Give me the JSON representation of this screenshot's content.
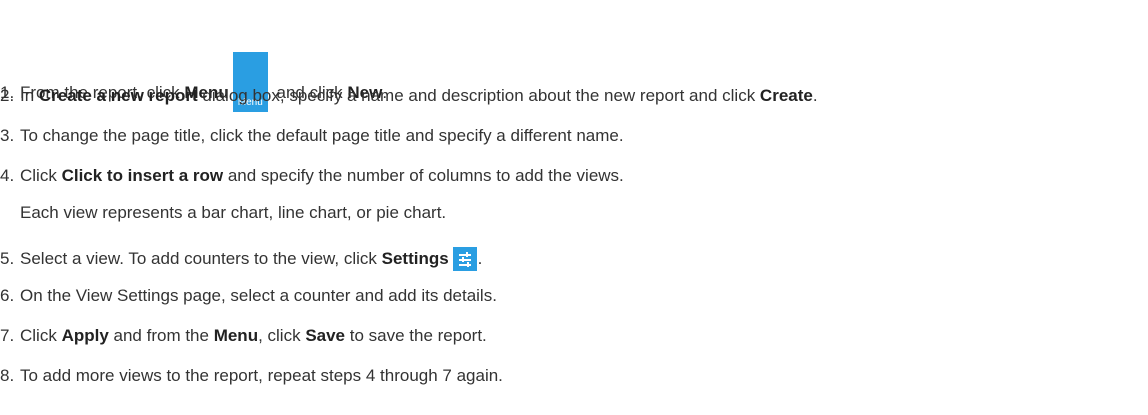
{
  "steps": [
    {
      "num": "1.",
      "t1": "From the report, click ",
      "b1": "Menu",
      "icon_label": "Menu",
      "t2": " and click ",
      "b2": "New",
      "t3": "."
    },
    {
      "num": "2.",
      "t1": "In ",
      "b1": "Create a new report",
      "t2": " dialog box, specify a name and description about the new report and click ",
      "b2": "Create",
      "t3": "."
    },
    {
      "num": "3.",
      "t1": "To change the page title, click the default page title and specify a different name."
    },
    {
      "num": "4.",
      "t1": "Click ",
      "b1": "Click to insert a row",
      "t2": " and specify the number of columns to add the views.",
      "sub": "Each view represents a bar chart, line chart, or pie chart."
    },
    {
      "num": "5.",
      "t1": "Select a view. To add counters to the view, click ",
      "b1": "Settings",
      "t2": "."
    },
    {
      "num": "6.",
      "t1": "On the View Settings page, select a counter and add its details."
    },
    {
      "num": "7.",
      "t1": "Click ",
      "b1": "Apply",
      "t2": " and from the ",
      "b2": "Menu",
      "t3": ", click ",
      "b3": "Save",
      "t4": " to save the report."
    },
    {
      "num": "8.",
      "t1": "To add more views to the report, repeat steps 4 through 7 again."
    }
  ],
  "icons": {
    "menu": "menu-hamburger-icon",
    "settings": "settings-sliders-icon",
    "icon_color": "#2a9ee2"
  }
}
